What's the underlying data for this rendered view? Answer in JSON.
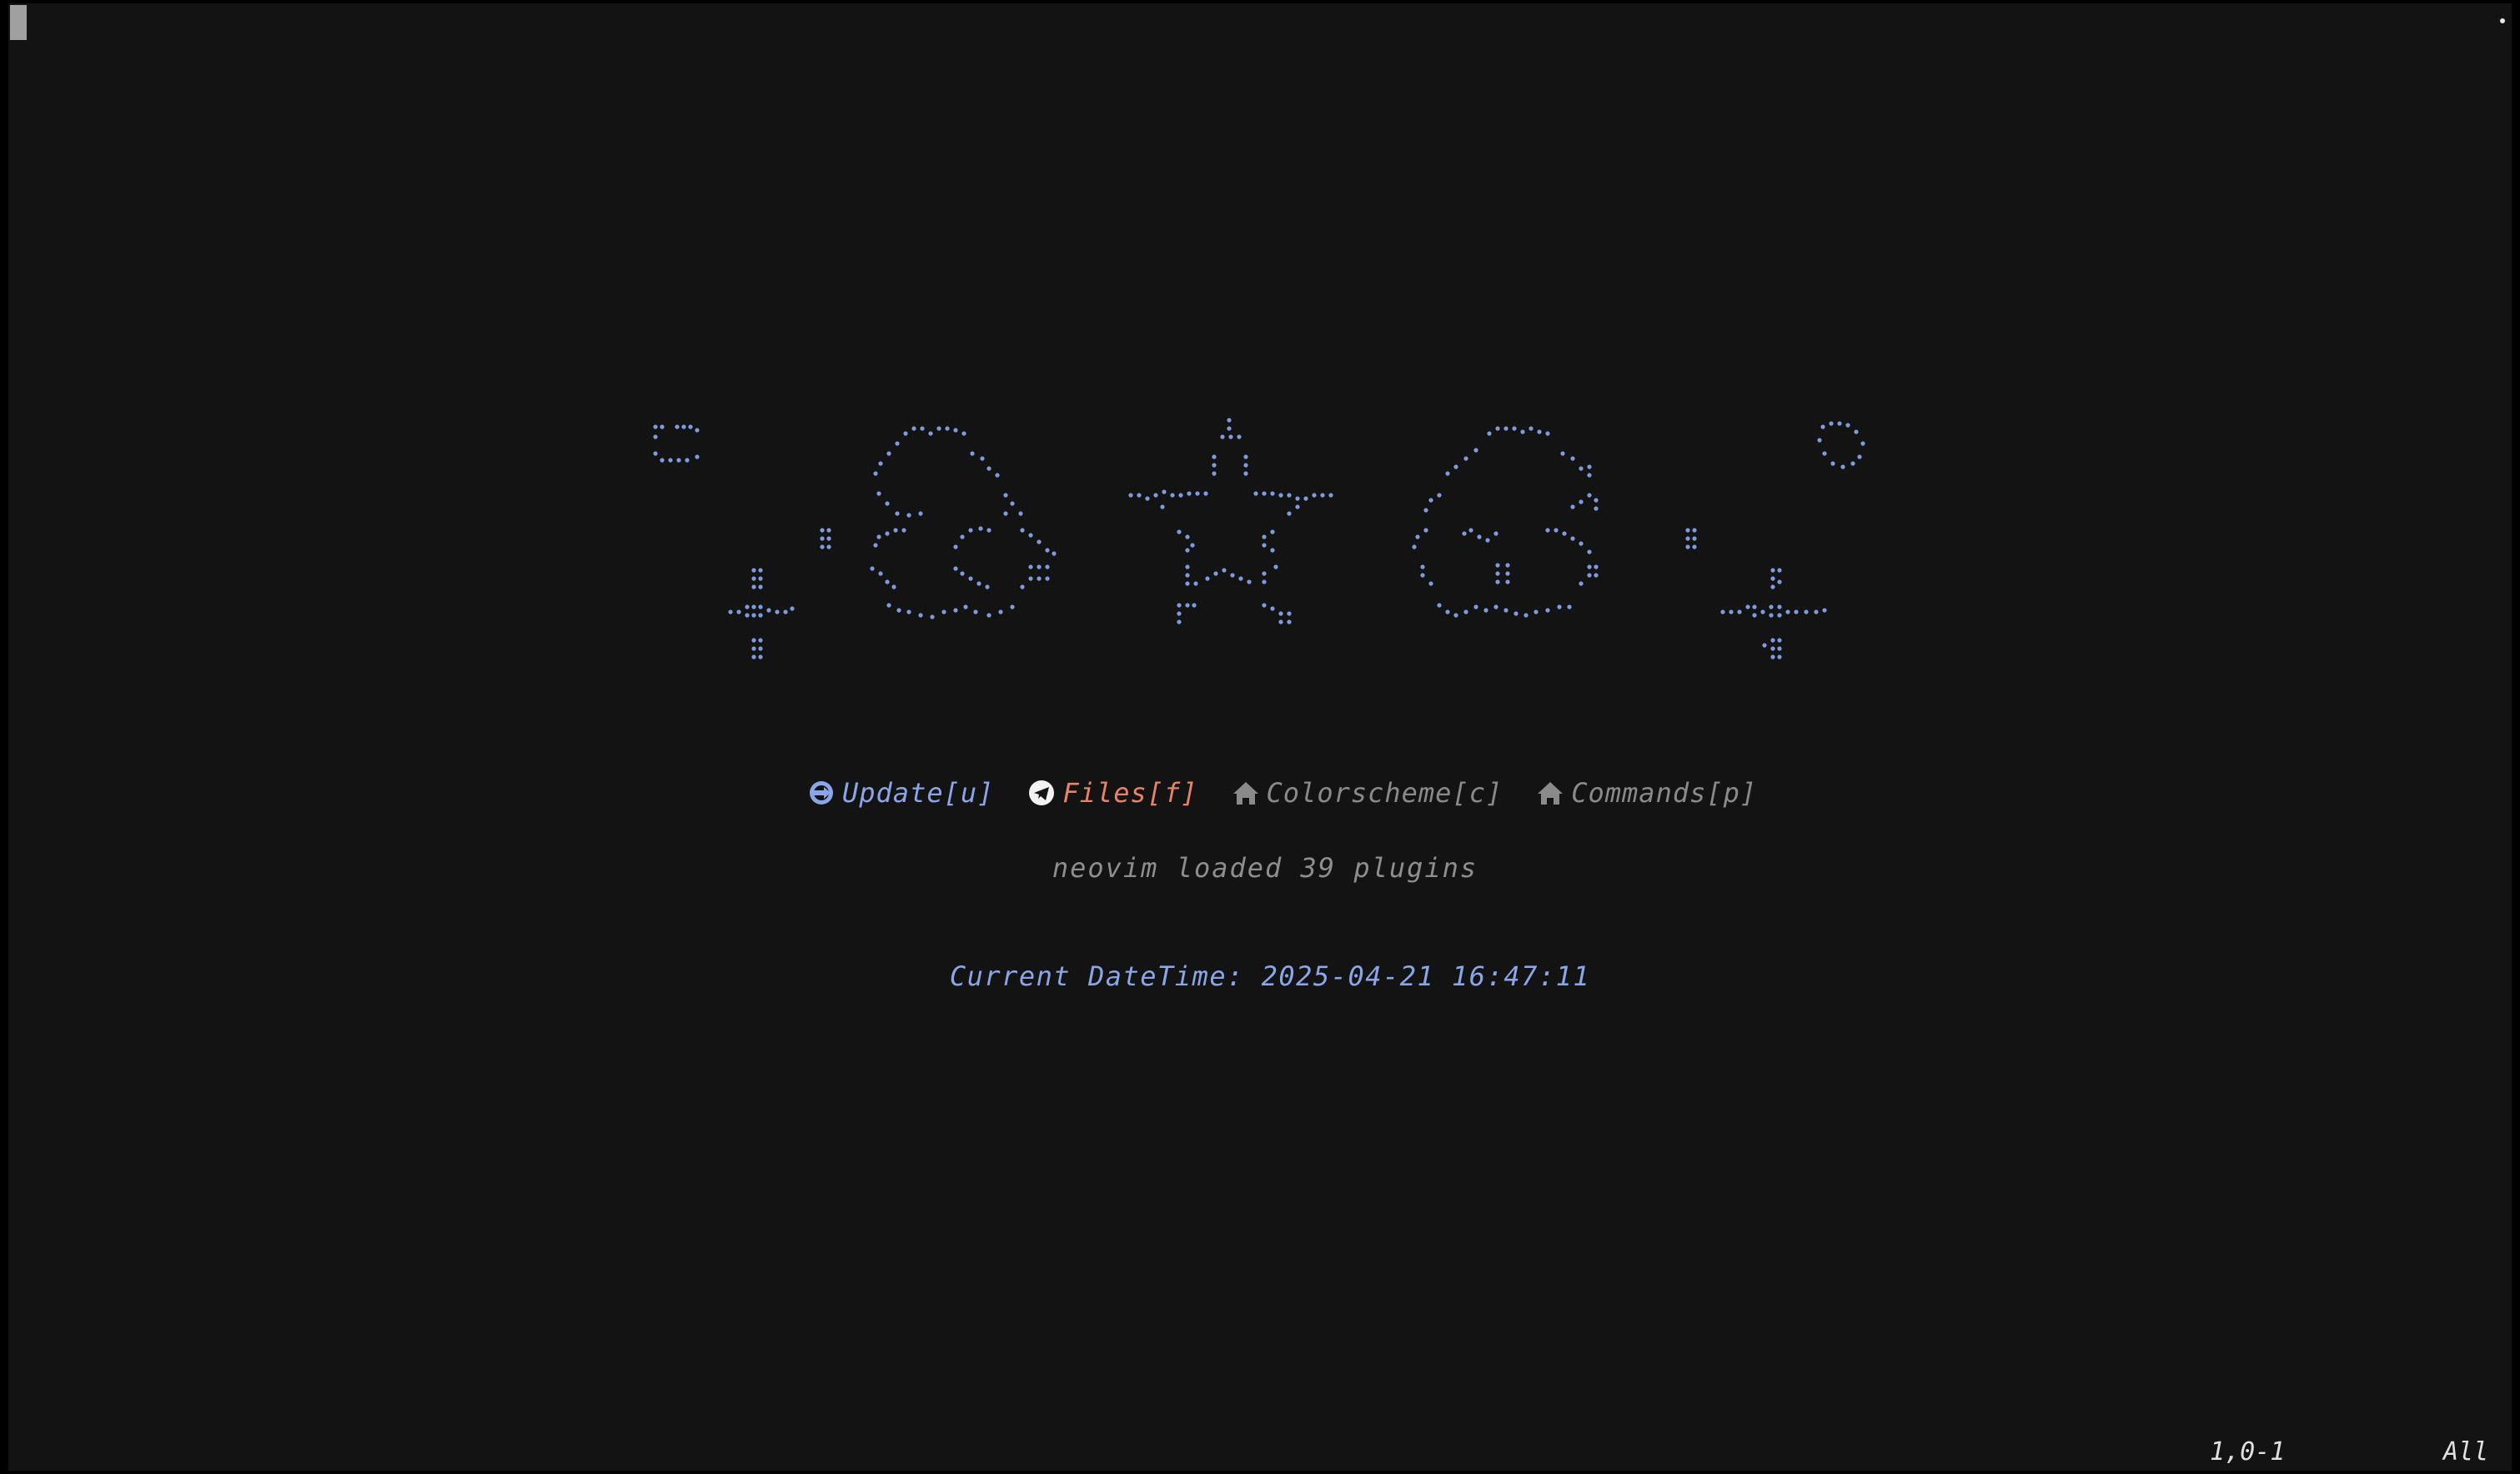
{
  "menu": {
    "update_label": "Update[u]",
    "files_label": "Files[f]",
    "colorscheme_label": "Colorscheme[c]",
    "commands_label": "Commands[p]"
  },
  "footer": "neovim loaded 39 plugins",
  "datetime": "Current DateTime: 2025-04-21 16:47:11",
  "status": {
    "ruler": "1,0-1",
    "scroll": "All"
  },
  "colors": {
    "background": "#131313",
    "accent": "#8aa6e8",
    "files": "#e8836a",
    "muted": "#8a8a8a"
  },
  "icons": {
    "update": "update-icon",
    "files": "telegram-icon",
    "colorscheme": "home-icon",
    "commands": "home-icon"
  }
}
